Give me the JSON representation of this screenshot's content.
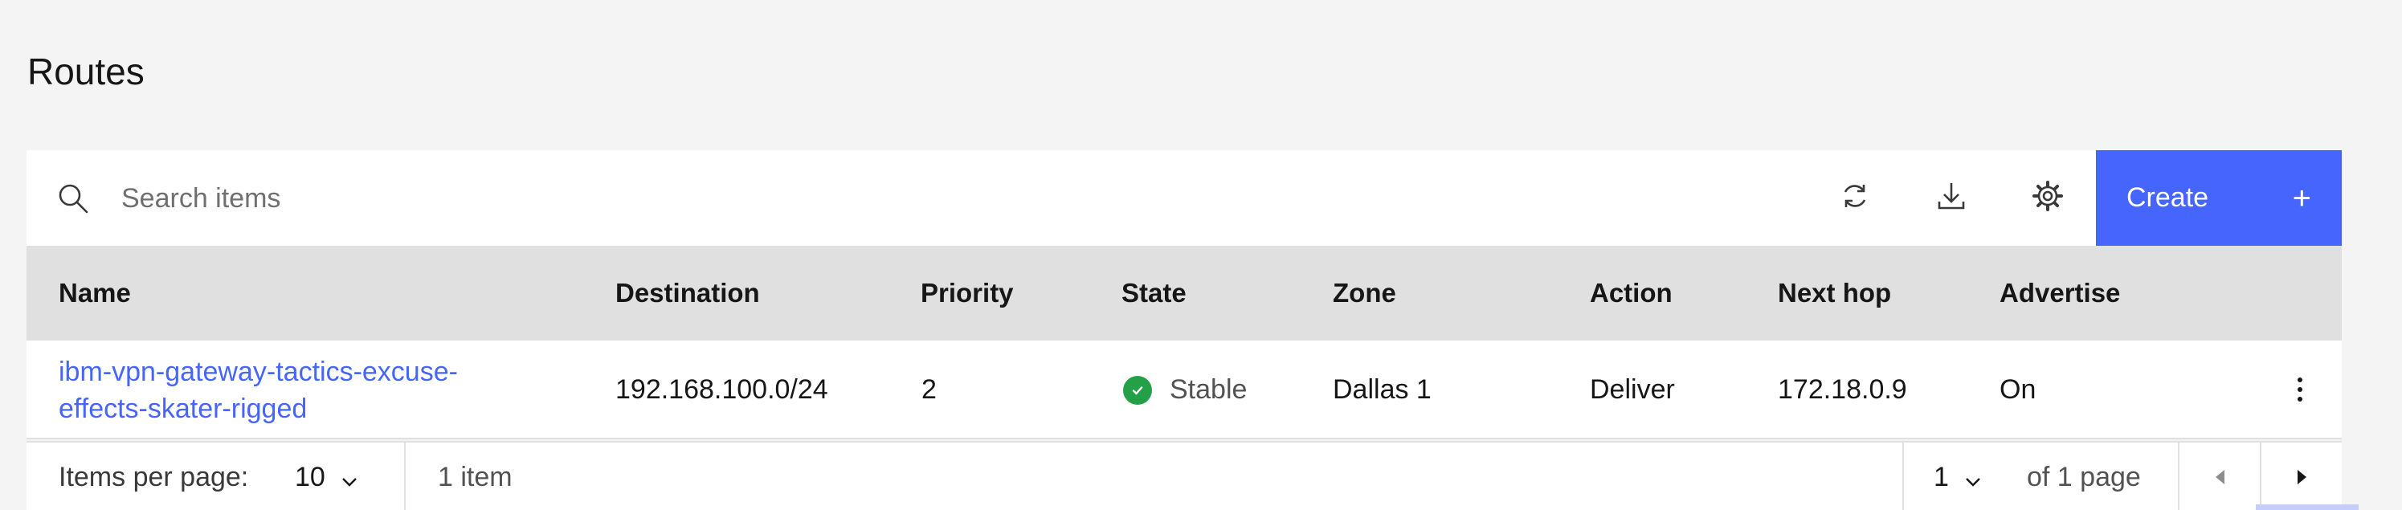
{
  "page": {
    "title": "Routes"
  },
  "toolbar": {
    "search_placeholder": "Search items",
    "search_value": "",
    "create_label": "Create",
    "icons": [
      "search-icon",
      "refresh-icon",
      "download-icon",
      "settings-icon",
      "plus-icon"
    ]
  },
  "table": {
    "columns": [
      "Name",
      "Destination",
      "Priority",
      "State",
      "Zone",
      "Action",
      "Next hop",
      "Advertise"
    ],
    "rows": [
      {
        "name": "ibm-vpn-gateway-tactics-excuse-effects-skater-rigged",
        "destination": "192.168.100.0/24",
        "priority": "2",
        "state": "Stable",
        "zone": "Dallas 1",
        "action": "Deliver",
        "next_hop": "172.18.0.9",
        "advertise": "On"
      }
    ]
  },
  "pagination": {
    "items_per_page_label": "Items per page:",
    "items_per_page": "10",
    "item_count": "1 item",
    "current_page": "1",
    "of_pages": "of 1 page"
  },
  "colors": {
    "accent": "#4565fc",
    "stable": "#24a148",
    "header_bg": "#e0e0e0",
    "page_bg": "#f4f4f4"
  }
}
